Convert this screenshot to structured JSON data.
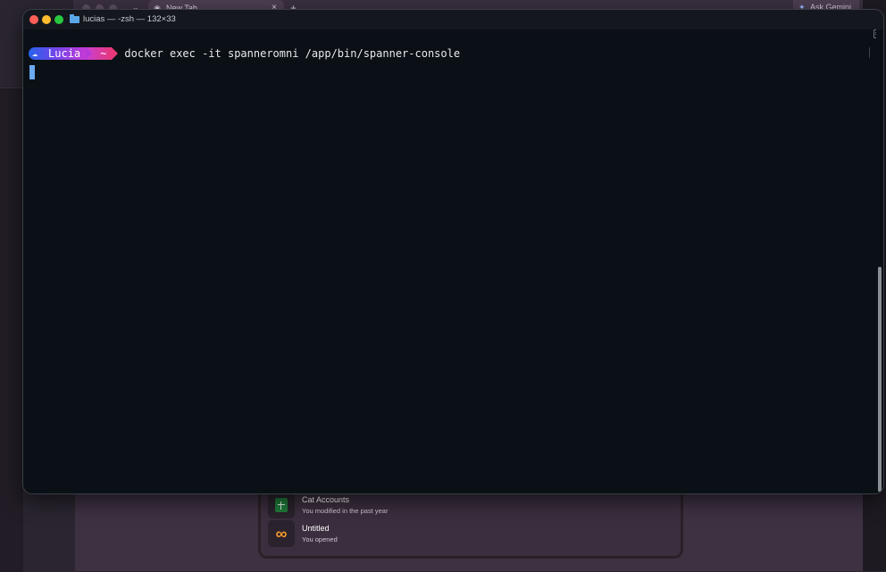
{
  "browser": {
    "tab_title": "New Tab",
    "tab_close": "×",
    "new_tab": "+",
    "tab_menu": "⌄",
    "gemini_label": "Ask Gemini",
    "gemini_icon": "✦",
    "recent_files": [
      {
        "title": "Cat Accounts",
        "subtitle": "You modified in the past year",
        "icon": "sheets-icon"
      },
      {
        "title": "Untitled",
        "subtitle": "You opened",
        "icon": "colab-icon",
        "glyph": "∞"
      }
    ]
  },
  "terminal": {
    "title": "lucias — -zsh — 132×33",
    "prompt": {
      "user": "Lucia",
      "dir": "~",
      "cloud_icon": "☁"
    },
    "command": "docker exec -it spanneromni /app/bin/spanner-console"
  },
  "colors": {
    "terminal_bg": "#0b1016",
    "prompt_user_bg_start": "#2563eb",
    "prompt_user_bg_end": "#c53ad6",
    "prompt_dir_bg": "#e6387a",
    "cursor": "#6ba9f0",
    "traffic_close": "#ff5f57",
    "traffic_minimize": "#febc2e",
    "traffic_zoom": "#28c840"
  }
}
